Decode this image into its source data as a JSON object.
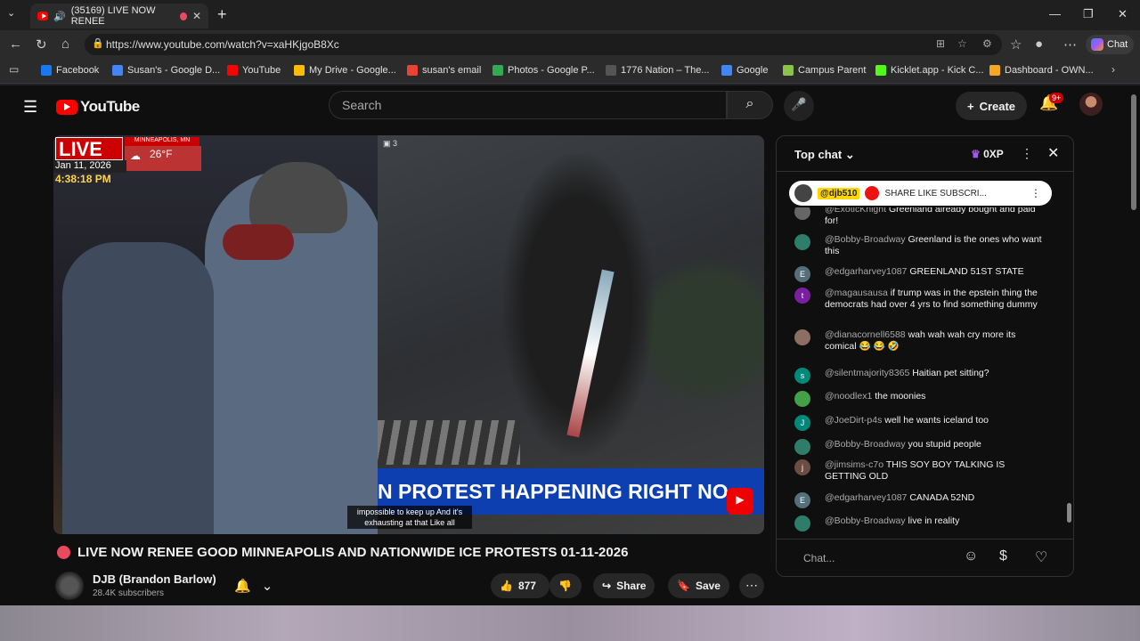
{
  "browser": {
    "tab_title": "(35169) LIVE NOW RENEE",
    "url": "https://www.youtube.com/watch?v=xaHKjgoB8Xc",
    "copilot_label": "Chat",
    "bookmarks": [
      {
        "label": "Facebook",
        "color": "#1877f2"
      },
      {
        "label": "Susan's - Google D...",
        "color": "#4285f4"
      },
      {
        "label": "YouTube",
        "color": "#ff0000"
      },
      {
        "label": "My Drive - Google...",
        "color": "#fbbc04"
      },
      {
        "label": "susan's email",
        "color": "#ea4335"
      },
      {
        "label": "Photos - Google P...",
        "color": "#34a853"
      },
      {
        "label": "1776 Nation – The...",
        "color": "#555555"
      },
      {
        "label": "Google",
        "color": "#4285f4"
      },
      {
        "label": "Campus Parent",
        "color": "#8bc34a"
      },
      {
        "label": "Kicklet.app - Kick C...",
        "color": "#53fc18"
      },
      {
        "label": "Dashboard - OWN...",
        "color": "#f5a623"
      }
    ]
  },
  "youtube": {
    "logo_text": "YouTube",
    "search_placeholder": "Search",
    "create_label": "Create",
    "notif_badge": "9+"
  },
  "video": {
    "live_label": "LIVE",
    "location": "MINNEAPOLIS, MN",
    "temperature": "26°F",
    "date": "Jan 11, 2026",
    "time": "4:38:18 PM",
    "cam_count": "3",
    "chyron": "N PROTEST HAPPENING RIGHT NO",
    "caption_line1": "impossible to keep up And it's",
    "caption_line2": "exhausting at that Like all",
    "title": "LIVE NOW RENEE GOOD MINNEAPOLIS AND NATIONWIDE ICE PROTESTS 01-11-2026",
    "channel": "DJB (Brandon Barlow)",
    "subscribers": "28.4K subscribers",
    "likes": "877",
    "share_label": "Share",
    "save_label": "Save"
  },
  "chat": {
    "header": "Top chat",
    "xp": "0XP",
    "pinned_user": "@djb510",
    "pinned_text": "SHARE LIKE SUBSCRI...",
    "input_placeholder": "Chat...",
    "messages": [
      {
        "user": "@ExoticKnight",
        "text": "Greenland already bought and paid for!",
        "initial": "",
        "color": "#666666"
      },
      {
        "user": "@Bobby-Broadway",
        "text": "Greenland is the ones who want this",
        "initial": "",
        "color": "#2e7d6b"
      },
      {
        "user": "@edgarharvey1087",
        "text": "GREENLAND 51ST STATE",
        "initial": "E",
        "color": "#546e7a"
      },
      {
        "user": "@magausausa",
        "text": "if trump was in the epstein thing the democrats had over 4 yrs to find something dummy",
        "initial": "t",
        "color": "#7b1fa2"
      },
      {
        "user": "@dianacornell6588",
        "text": "wah wah wah cry more its comical 😂 😂 🤣",
        "initial": "",
        "color": "#8d6e63"
      },
      {
        "user": "@silentmajority8365",
        "text": "Haitian pet sitting?",
        "initial": "s",
        "color": "#00897b"
      },
      {
        "user": "@noodlex1",
        "text": "the moonies",
        "initial": "",
        "color": "#43a047"
      },
      {
        "user": "@JoeDirt-p4s",
        "text": "well he wants iceland too",
        "initial": "J",
        "color": "#00897b"
      },
      {
        "user": "@Bobby-Broadway",
        "text": "you stupid people",
        "initial": "",
        "color": "#2e7d6b"
      },
      {
        "user": "@jimsims-c7o",
        "text": "THIS SOY BOY TALKING IS GETTING OLD",
        "initial": "j",
        "color": "#6d4c41"
      },
      {
        "user": "@edgarharvey1087",
        "text": "CANADA 52ND",
        "initial": "E",
        "color": "#546e7a"
      },
      {
        "user": "@Bobby-Broadway",
        "text": "live in reality",
        "initial": "",
        "color": "#2e7d6b"
      }
    ]
  }
}
